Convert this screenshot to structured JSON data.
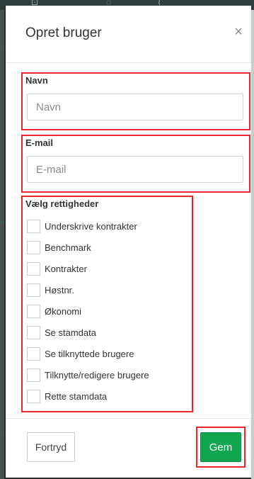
{
  "modal": {
    "title": "Opret bruger",
    "close_symbol": "×"
  },
  "name_field": {
    "label": "Navn",
    "placeholder": "Navn"
  },
  "email_field": {
    "label": "E-mail",
    "placeholder": "E-mail"
  },
  "permissions": {
    "label": "Vælg rettigheder",
    "items": [
      {
        "label": "Underskrive kontrakter",
        "checked": false
      },
      {
        "label": "Benchmark",
        "checked": false
      },
      {
        "label": "Kontrakter",
        "checked": false
      },
      {
        "label": "Høstnr.",
        "checked": false
      },
      {
        "label": "Økonomi",
        "checked": false
      },
      {
        "label": "Se stamdata",
        "checked": false
      },
      {
        "label": "Se tilknyttede brugere",
        "checked": false
      },
      {
        "label": "Tilknytte/redigere brugere",
        "checked": false
      },
      {
        "label": "Rette stamdata",
        "checked": false
      }
    ]
  },
  "footer": {
    "cancel_label": "Fortryd",
    "save_label": "Gem"
  },
  "colors": {
    "highlight": "#e8262e",
    "save_button": "#12a651",
    "background_bar": "#2f3e3f"
  },
  "icons": {
    "close": "close-icon"
  }
}
